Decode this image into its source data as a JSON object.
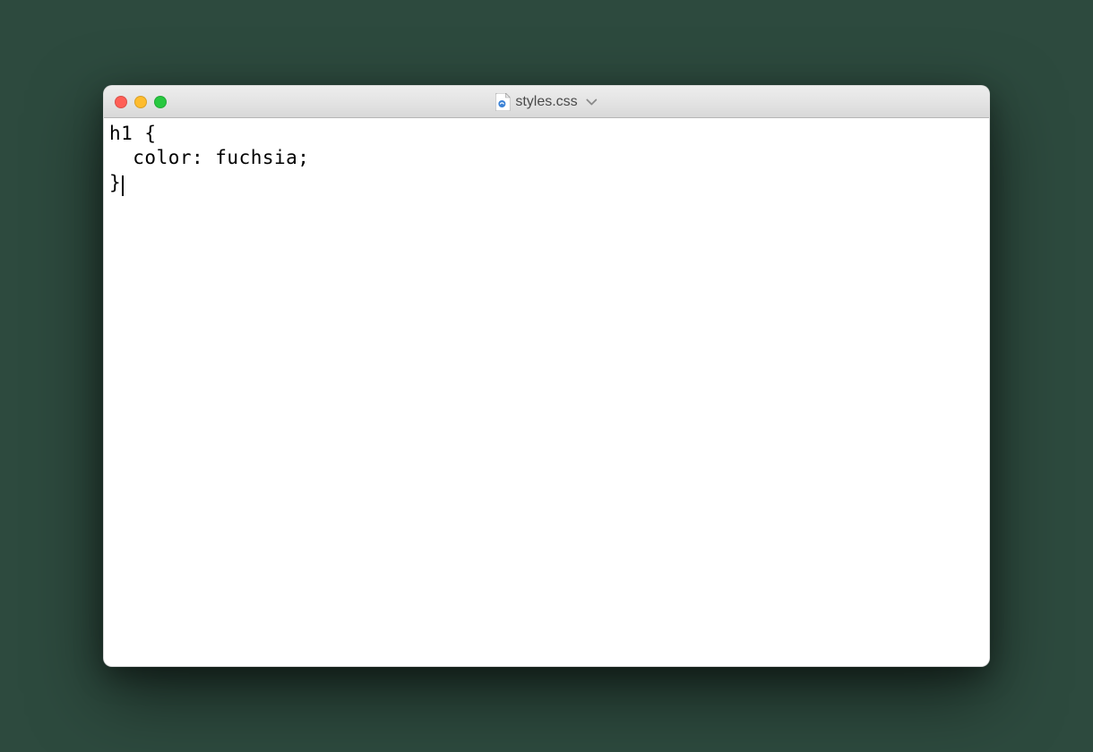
{
  "window": {
    "filename": "styles.css",
    "traffic_lights": {
      "close": "close",
      "minimize": "minimize",
      "zoom": "zoom"
    }
  },
  "editor": {
    "lines": [
      "h1 {",
      "  color: fuchsia;",
      "}"
    ],
    "cursor_line": 2,
    "cursor_after": "}"
  }
}
